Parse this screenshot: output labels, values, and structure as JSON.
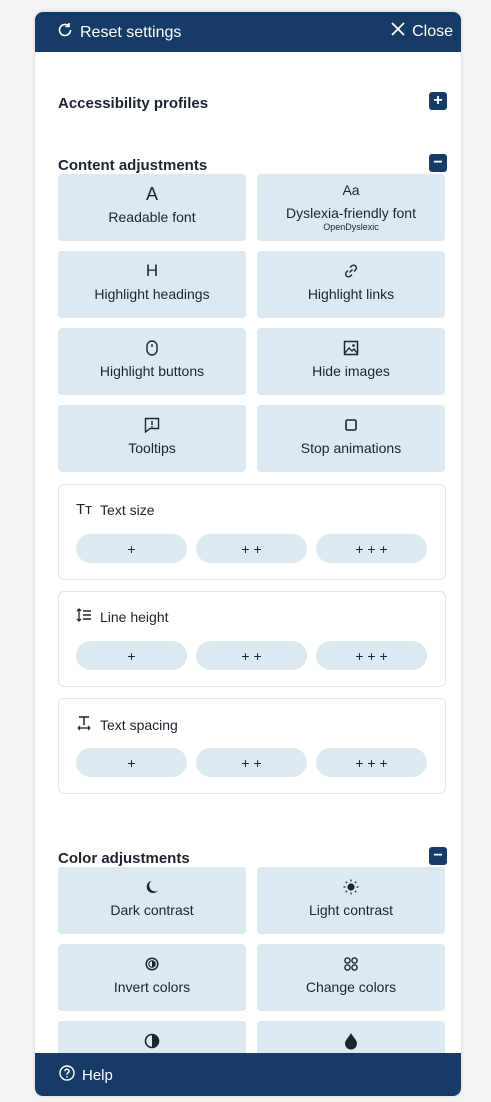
{
  "header": {
    "reset_label": "Reset settings",
    "close_label": "Close"
  },
  "sections": {
    "profiles": {
      "title": "Accessibility profiles",
      "toggle": "+"
    },
    "content": {
      "title": "Content adjustments",
      "toggle": "−"
    },
    "color": {
      "title": "Color adjustments",
      "toggle": "−"
    }
  },
  "content_cards": [
    {
      "icon": "A",
      "label": "Readable font"
    },
    {
      "icon": "Aa",
      "label": "Dyslexia-friendly font",
      "sub": "OpenDyslexic"
    },
    {
      "icon": "H",
      "label": "Highlight headings"
    },
    {
      "icon": "link-icon",
      "label": "Highlight links"
    },
    {
      "icon": "mouse-icon",
      "label": "Highlight buttons"
    },
    {
      "icon": "image-icon",
      "label": "Hide images"
    },
    {
      "icon": "tooltip-icon",
      "label": "Tooltips"
    },
    {
      "icon": "square-icon",
      "label": "Stop animations"
    }
  ],
  "text_settings": [
    {
      "icon": "Tт",
      "label": "Text size",
      "options": [
        "+",
        "+ +",
        "+ + +"
      ]
    },
    {
      "icon": "line-height-icon",
      "label": "Line height",
      "options": [
        "+",
        "+ +",
        "+ + +"
      ]
    },
    {
      "icon": "text-spacing-icon",
      "label": "Text spacing",
      "options": [
        "+",
        "+ +",
        "+ + +"
      ]
    }
  ],
  "color_cards": [
    {
      "icon": "moon-icon",
      "label": "Dark contrast"
    },
    {
      "icon": "sun-icon",
      "label": "Light contrast"
    },
    {
      "icon": "invert-icon",
      "label": "Invert colors"
    },
    {
      "icon": "change-colors-icon",
      "label": "Change colors"
    },
    {
      "icon": "half-circle-icon",
      "label": ""
    },
    {
      "icon": "drop-icon",
      "label": ""
    }
  ],
  "footer": {
    "help_label": "Help"
  },
  "colors": {
    "primary": "#163b66",
    "card": "#dce9f1"
  }
}
